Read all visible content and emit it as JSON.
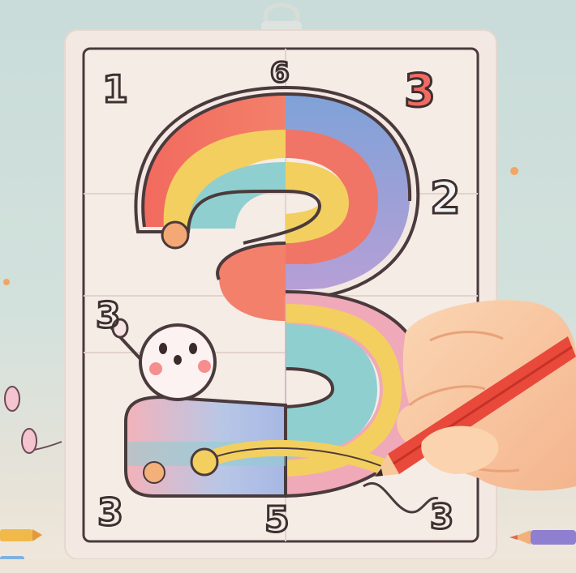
{
  "corner_numbers": {
    "top_left": "1",
    "top_center": "6",
    "top_right": "3",
    "mid_right": "2",
    "mid_left": "3",
    "bottom_left": "3",
    "bottom_center": "5",
    "bottom_right": "3"
  },
  "colors": {
    "background": "#cddcd8",
    "card": "#f3e8e2",
    "outline": "#4a3a3c",
    "red": "#f07566",
    "yellow": "#f3cf60",
    "teal": "#8fcfd0",
    "blue": "#7f9fd8",
    "pink": "#f0a9b8",
    "pencil": "#e8493a"
  },
  "icons": {
    "hand": "hand-holding-pencil-icon",
    "character": "smiling-blob-character-icon",
    "pencil": "red-pencil-icon"
  }
}
